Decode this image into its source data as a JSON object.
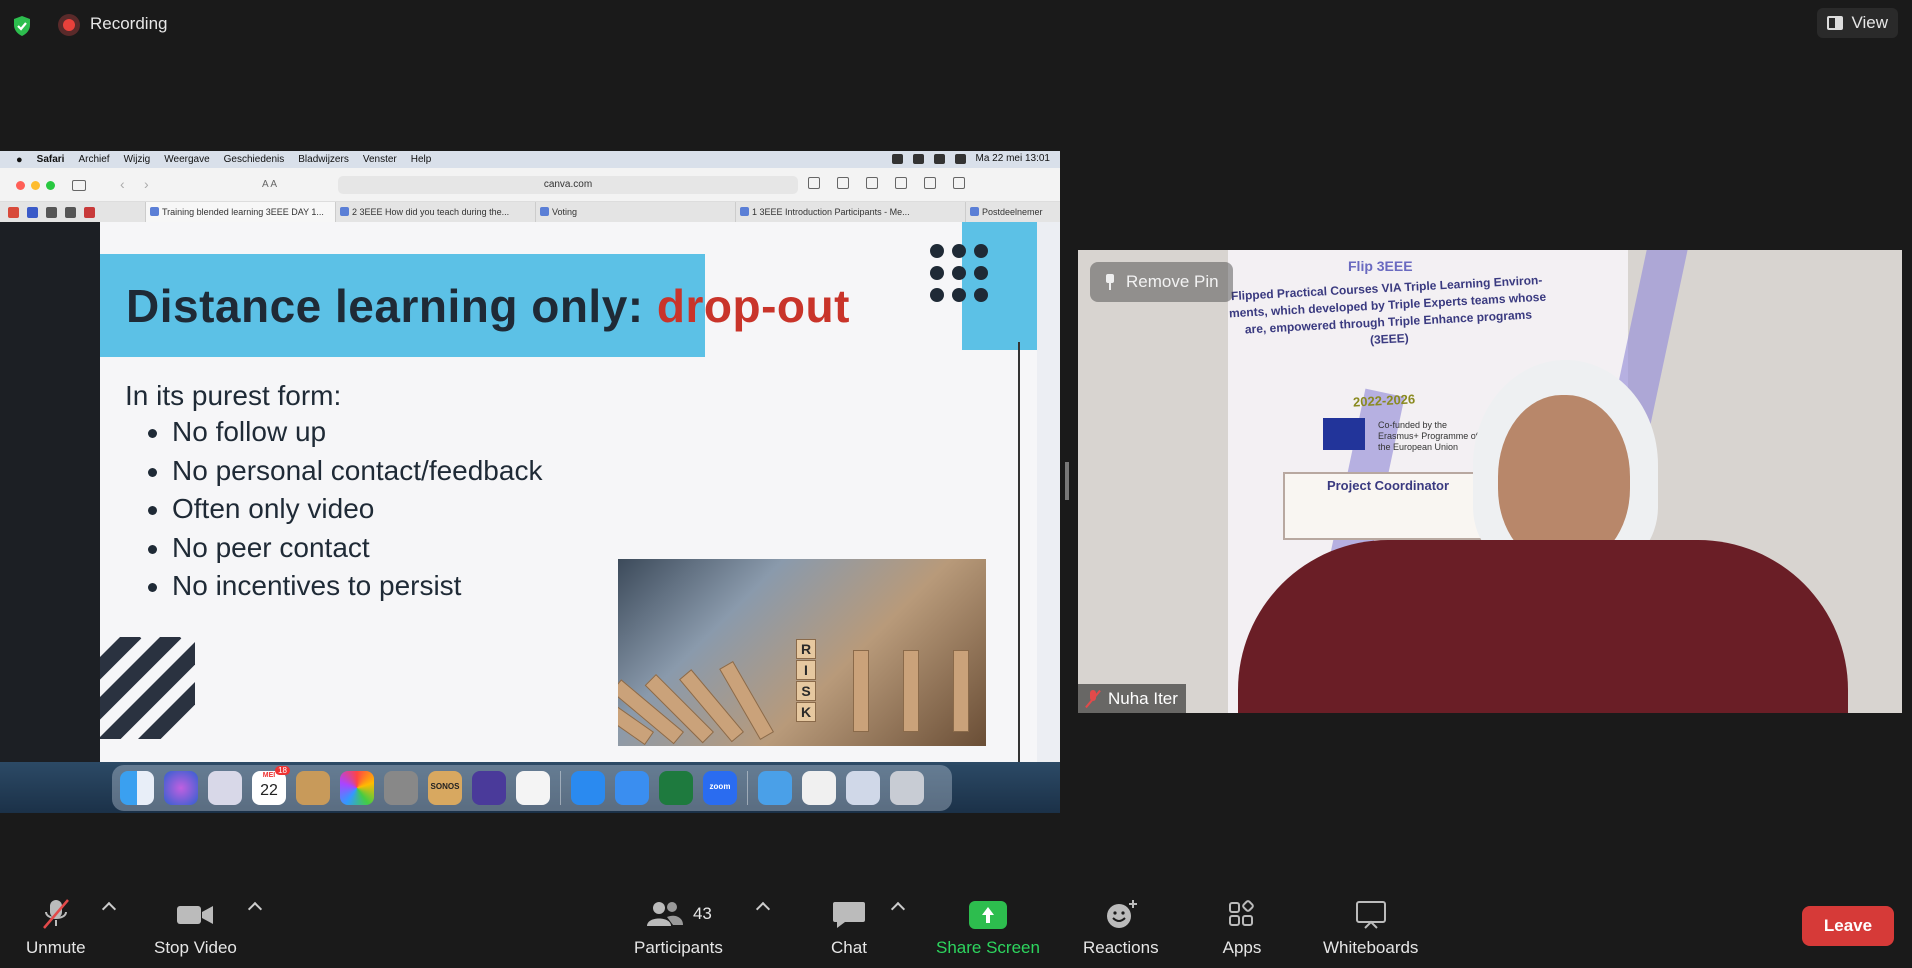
{
  "topbar": {
    "recording_label": "Recording",
    "view_label": "View"
  },
  "shared_screen": {
    "mac_menu": [
      "Safari",
      "Archief",
      "Wijzig",
      "Weergave",
      "Geschiedenis",
      "Bladwijzers",
      "Venster",
      "Help"
    ],
    "mac_datetime": "Ma 22 mei  13:01",
    "url": "canva.com",
    "tabs": [
      "Training blended learning 3EEE DAY 1...",
      "2 3EEE How did you teach during the...",
      "Voting",
      "1 3EEE Introduction Participants - Me...",
      "Postdeelnemer"
    ],
    "slide": {
      "title_main": "Distance learning only:",
      "title_accent": "drop-out",
      "intro": "In its purest form:",
      "bullets": [
        "No follow up",
        "No personal contact/feedback",
        "Often only video",
        "No peer contact",
        "No incentives to persist"
      ],
      "photo_dice_letters": [
        "R",
        "I",
        "S",
        "K"
      ]
    },
    "dock": {
      "calendar_month": "MEI",
      "calendar_day": "22",
      "calendar_badge": "18",
      "sonos_label": "SONOS",
      "zoom_label": "zoom"
    }
  },
  "video_tile": {
    "remove_pin_label": "Remove Pin",
    "participant_name": "Nuha Iter",
    "banner": {
      "flip": "Flip 3EEE",
      "text": "Flipped Practical Courses VIA Triple Learning Environ-ments, which developed by Triple Experts teams whose are, empowered through Triple Enhance programs (3EEE)",
      "years": "2022-2026",
      "eu_text": "Co-funded by the Erasmus+ Programme of the European Union",
      "coordinator": "Project Coordinator"
    }
  },
  "toolbar": {
    "unmute": "Unmute",
    "stop_video": "Stop Video",
    "participants": "Participants",
    "participants_count": "43",
    "chat": "Chat",
    "share_screen": "Share Screen",
    "reactions": "Reactions",
    "apps": "Apps",
    "whiteboards": "Whiteboards",
    "leave": "Leave"
  },
  "colors": {
    "accent_green": "#2dbd4e",
    "leave_red": "#d63a38",
    "slide_blue": "#5cc1e6",
    "slide_accent_red": "#c9342a"
  }
}
